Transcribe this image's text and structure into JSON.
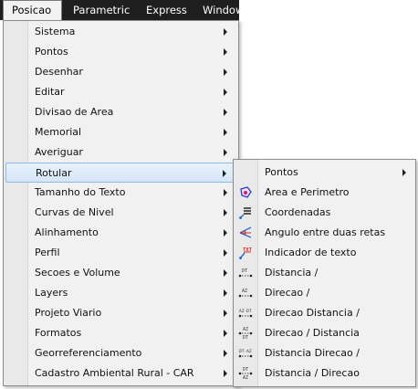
{
  "menubar": {
    "items": [
      "Posicao",
      "Parametric",
      "Express",
      "Window"
    ]
  },
  "dropdown": {
    "items": [
      "Sistema",
      "Pontos",
      "Desenhar",
      "Editar",
      "Divisao de Area",
      "Memorial",
      "Averiguar",
      "Rotular",
      "Tamanho do Texto",
      "Curvas de Nivel",
      "Alinhamento",
      "Perfil",
      "Secoes e Volume",
      "Layers",
      "Projeto Viario",
      "Formatos",
      "Georreferenciamento",
      "Cadastro Ambiental Rural - CAR"
    ],
    "highlighted": "Rotular"
  },
  "submenu": {
    "items": [
      {
        "label": "Pontos",
        "icon": "none",
        "has_arrow": true
      },
      {
        "label": "Area e Perimetro",
        "icon": "area-perimeter-icon"
      },
      {
        "label": "Coordenadas",
        "icon": "coordinates-icon"
      },
      {
        "label": "Angulo entre duas retas",
        "icon": "angle-icon"
      },
      {
        "label": "Indicador de texto",
        "icon": "text-indicator-icon"
      },
      {
        "label": "Distancia /",
        "icon": "distance-icon"
      },
      {
        "label": "Direcao /",
        "icon": "direction-icon"
      },
      {
        "label": "Direcao Distancia /",
        "icon": "direction-distance-icon"
      },
      {
        "label": "Direcao / Distancia",
        "icon": "direction-over-distance-icon"
      },
      {
        "label": "Distancia Direcao /",
        "icon": "distance-direction-icon"
      },
      {
        "label": "Distancia / Direcao",
        "icon": "distance-over-direction-icon"
      }
    ],
    "icon_text": {
      "txt": "TXT",
      "dt": "DT",
      "az": "AZ",
      "az_dt": "AZ-DT",
      "dt_az": "DT-AZ"
    }
  },
  "colors": {
    "menubar_bg": "#1f1f1f",
    "menu_bg": "#f1f1f1",
    "highlight_border": "#8fb8e6"
  }
}
